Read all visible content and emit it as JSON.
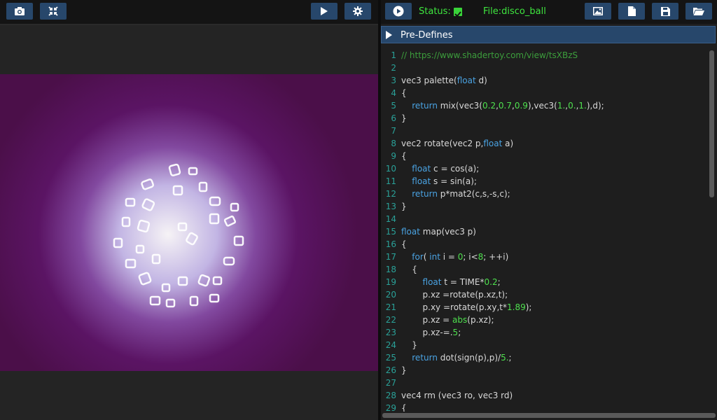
{
  "left_toolbar": {
    "icons": [
      "camera-icon",
      "fullscreen-toggle-icon",
      "play-icon",
      "gear-icon"
    ]
  },
  "right_toolbar": {
    "status_label": "Status:",
    "status_checked": true,
    "file_label": "File:disco_ball",
    "icons": [
      "play-circle-icon",
      "image-icon",
      "new-file-icon",
      "save-icon",
      "open-folder-icon"
    ]
  },
  "predefines": {
    "label": "Pre-Defines",
    "icon": "triangle-right-icon"
  },
  "colors": {
    "accent_button": "#27476b",
    "status_green": "#3ee63e",
    "line_number": "#2aa198",
    "keyword": "#4aa3e3",
    "number": "#4ee04e",
    "comment": "#3c9e3c"
  },
  "code": {
    "lines": [
      {
        "n": "1",
        "tokens": [
          {
            "t": "// https://www.shadertoy.com/view/tsXBzS",
            "c": "comment"
          }
        ]
      },
      {
        "n": "2",
        "tokens": []
      },
      {
        "n": "3",
        "tokens": [
          {
            "t": "vec3 palette(",
            "c": ""
          },
          {
            "t": "float",
            "c": "kw"
          },
          {
            "t": " d)",
            "c": ""
          }
        ]
      },
      {
        "n": "4",
        "tokens": [
          {
            "t": "{",
            "c": ""
          }
        ]
      },
      {
        "n": "5",
        "tokens": [
          {
            "t": "    ",
            "c": ""
          },
          {
            "t": "return",
            "c": "kw"
          },
          {
            "t": " mix(vec3(",
            "c": ""
          },
          {
            "t": "0.2",
            "c": "num"
          },
          {
            "t": ",",
            "c": ""
          },
          {
            "t": "0.7",
            "c": "num"
          },
          {
            "t": ",",
            "c": ""
          },
          {
            "t": "0.9",
            "c": "num"
          },
          {
            "t": "),vec3(",
            "c": ""
          },
          {
            "t": "1.",
            "c": "num"
          },
          {
            "t": ",",
            "c": ""
          },
          {
            "t": "0.",
            "c": "num"
          },
          {
            "t": ",",
            "c": ""
          },
          {
            "t": "1.",
            "c": "num"
          },
          {
            "t": "),d);",
            "c": ""
          }
        ]
      },
      {
        "n": "6",
        "tokens": [
          {
            "t": "}",
            "c": ""
          }
        ]
      },
      {
        "n": "7",
        "tokens": []
      },
      {
        "n": "8",
        "tokens": [
          {
            "t": "vec2 rotate(vec2 p,",
            "c": ""
          },
          {
            "t": "float",
            "c": "kw"
          },
          {
            "t": " a)",
            "c": ""
          }
        ]
      },
      {
        "n": "9",
        "tokens": [
          {
            "t": "{",
            "c": ""
          }
        ]
      },
      {
        "n": "10",
        "tokens": [
          {
            "t": "    ",
            "c": ""
          },
          {
            "t": "float",
            "c": "kw"
          },
          {
            "t": " c = cos(a);",
            "c": ""
          }
        ]
      },
      {
        "n": "11",
        "tokens": [
          {
            "t": "    ",
            "c": ""
          },
          {
            "t": "float",
            "c": "kw"
          },
          {
            "t": " s = sin(a);",
            "c": ""
          }
        ]
      },
      {
        "n": "12",
        "tokens": [
          {
            "t": "    ",
            "c": ""
          },
          {
            "t": "return",
            "c": "kw"
          },
          {
            "t": " p*mat2(c,s,-s,c);",
            "c": ""
          }
        ]
      },
      {
        "n": "13",
        "tokens": [
          {
            "t": "}",
            "c": ""
          }
        ]
      },
      {
        "n": "14",
        "tokens": []
      },
      {
        "n": "15",
        "tokens": [
          {
            "t": "float",
            "c": "kw"
          },
          {
            "t": " map(vec3 p)",
            "c": ""
          }
        ]
      },
      {
        "n": "16",
        "tokens": [
          {
            "t": "{",
            "c": ""
          }
        ]
      },
      {
        "n": "17",
        "tokens": [
          {
            "t": "    ",
            "c": ""
          },
          {
            "t": "for",
            "c": "kw"
          },
          {
            "t": "( ",
            "c": ""
          },
          {
            "t": "int",
            "c": "kw"
          },
          {
            "t": " i = ",
            "c": ""
          },
          {
            "t": "0",
            "c": "num"
          },
          {
            "t": "; i<",
            "c": ""
          },
          {
            "t": "8",
            "c": "num"
          },
          {
            "t": "; ++i)",
            "c": ""
          }
        ]
      },
      {
        "n": "18",
        "tokens": [
          {
            "t": "    {",
            "c": ""
          }
        ]
      },
      {
        "n": "19",
        "tokens": [
          {
            "t": "        ",
            "c": ""
          },
          {
            "t": "float",
            "c": "kw"
          },
          {
            "t": " t = TIME*",
            "c": ""
          },
          {
            "t": "0.2",
            "c": "num"
          },
          {
            "t": ";",
            "c": ""
          }
        ]
      },
      {
        "n": "20",
        "tokens": [
          {
            "t": "        p.xz =rotate(p.xz,t);",
            "c": ""
          }
        ]
      },
      {
        "n": "21",
        "tokens": [
          {
            "t": "        p.xy =rotate(p.xy,t*",
            "c": ""
          },
          {
            "t": "1.89",
            "c": "num"
          },
          {
            "t": ");",
            "c": ""
          }
        ]
      },
      {
        "n": "22",
        "tokens": [
          {
            "t": "        p.xz = ",
            "c": ""
          },
          {
            "t": "abs",
            "c": "num"
          },
          {
            "t": "(p.xz);",
            "c": ""
          }
        ]
      },
      {
        "n": "23",
        "tokens": [
          {
            "t": "        p.xz-=.",
            "c": ""
          },
          {
            "t": "5",
            "c": "num"
          },
          {
            "t": ";",
            "c": ""
          }
        ]
      },
      {
        "n": "24",
        "tokens": [
          {
            "t": "    }",
            "c": ""
          }
        ]
      },
      {
        "n": "25",
        "tokens": [
          {
            "t": "    ",
            "c": ""
          },
          {
            "t": "return",
            "c": "kw"
          },
          {
            "t": " dot(sign(p),p)/",
            "c": ""
          },
          {
            "t": "5.",
            "c": "num"
          },
          {
            "t": ";",
            "c": ""
          }
        ]
      },
      {
        "n": "26",
        "tokens": [
          {
            "t": "}",
            "c": ""
          }
        ]
      },
      {
        "n": "27",
        "tokens": []
      },
      {
        "n": "28",
        "tokens": [
          {
            "t": "vec4 rm (vec3 ro, vec3 rd)",
            "c": ""
          }
        ]
      },
      {
        "n": "29",
        "tokens": [
          {
            "t": "{",
            "c": ""
          }
        ]
      }
    ]
  }
}
